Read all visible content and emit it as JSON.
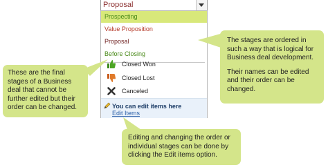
{
  "dropdown": {
    "selected_value": "Proposal"
  },
  "stages": [
    {
      "label": "Prospecting",
      "color": "#4a8a1a",
      "selected": true
    },
    {
      "label": "Value Proposition",
      "color": "#b63a2a",
      "selected": false
    },
    {
      "label": "Proposal",
      "color": "#6e1f1f",
      "selected": false
    },
    {
      "label": "Before Closing",
      "color": "#4a8a1a",
      "selected": false
    }
  ],
  "final_stages": [
    {
      "label": "Closed Won",
      "icon": "thumbs-up-icon",
      "icon_color": "#3a8a1a"
    },
    {
      "label": "Closed Lost",
      "icon": "thumbs-down-icon",
      "icon_color": "#c85a1a"
    },
    {
      "label": "Canceled",
      "icon": "close-icon",
      "icon_color": "#333333"
    }
  ],
  "edit_section": {
    "heading": "You can edit items here",
    "link": "Edit Items"
  },
  "callouts": {
    "left": "These are the final stages of a Business deal that cannot be further edited but their order can be changed.",
    "right_1": "The stages are ordered in such a way that is logical for Business deal development.",
    "right_2": "Their names can be edited and their order can be changed.",
    "bottom": "Editing and changing the order or individual stages can be done by clicking the Edit items option."
  },
  "colors": {
    "callout_bg": "#d4e58a",
    "selected_bg": "#d8e87a",
    "edit_bg": "#e9f1fa",
    "link": "#2a5fa8"
  }
}
